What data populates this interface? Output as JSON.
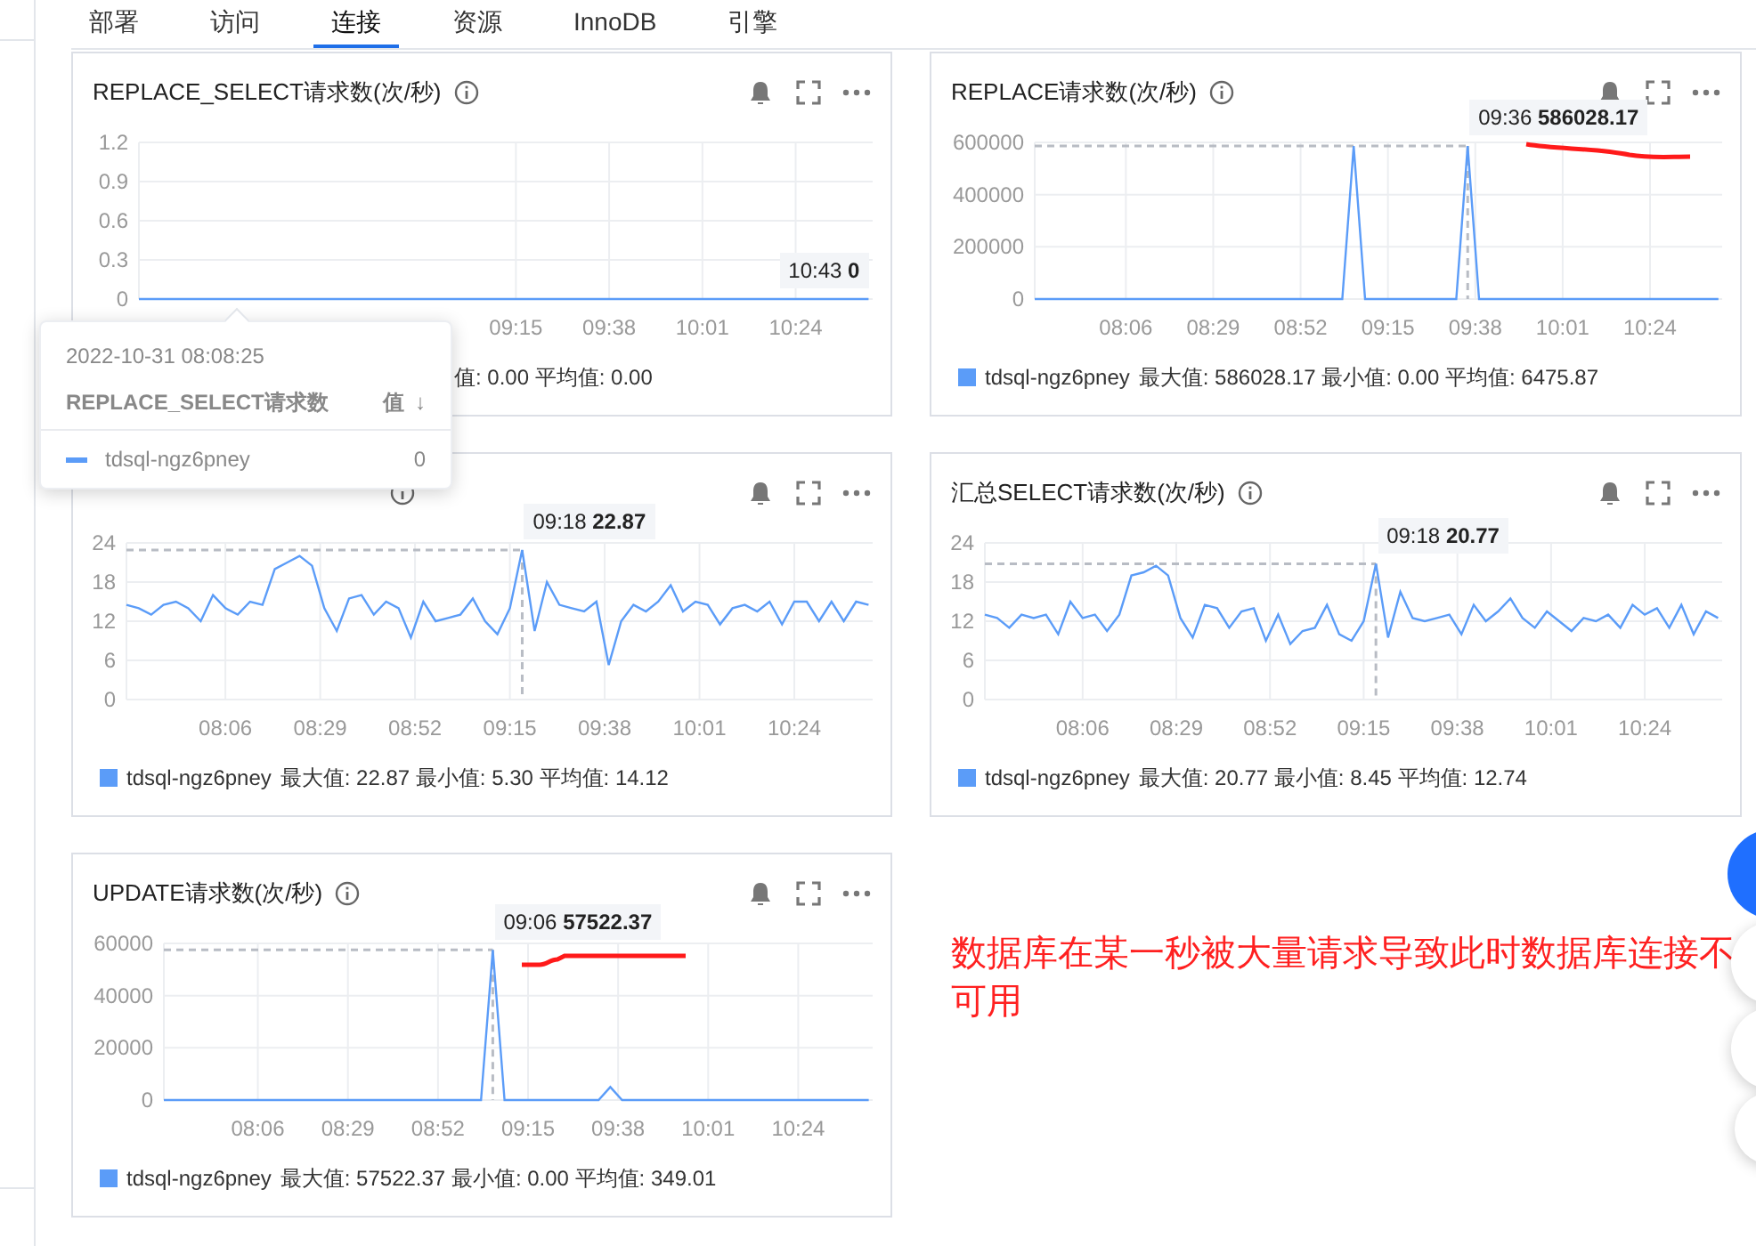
{
  "tabs": [
    {
      "label": "部署",
      "selected": false
    },
    {
      "label": "访问",
      "selected": false
    },
    {
      "label": "连接",
      "selected": true
    },
    {
      "label": "资源",
      "selected": false
    },
    {
      "label": "InnoDB",
      "selected": false
    },
    {
      "label": "引擎",
      "selected": false
    }
  ],
  "cards": [
    {
      "title": "REPLACE_SELECT请求数(次/秒)",
      "legend": {
        "swatch": false,
        "stats": "值: 0.00 平均值: 0.00"
      },
      "chart_data": {
        "type": "line",
        "grid": true,
        "annotations": [
          {
            "x": 642,
            "y": 0,
            "text": "10:43 **0**"
          }
        ],
        "x": [
          462,
          465,
          468,
          471,
          474,
          477,
          480,
          483,
          486,
          489,
          492,
          495,
          498,
          501,
          504,
          507,
          510,
          513,
          516,
          519,
          522,
          525,
          528,
          531,
          534,
          537,
          540,
          543,
          546,
          549,
          552,
          555,
          558,
          561,
          564,
          567,
          570,
          573,
          576,
          579,
          582,
          585,
          588,
          591,
          594,
          597,
          600,
          603,
          606,
          609,
          612,
          615,
          618,
          621,
          624,
          627,
          630,
          633,
          636,
          639,
          642
        ],
        "series": [
          {
            "color": "#5b9cf8",
            "values": [
              0,
              0,
              0,
              0,
              0,
              0,
              0,
              0,
              0,
              0,
              0,
              0,
              0,
              0,
              0,
              0,
              0,
              0,
              0,
              0,
              0,
              0,
              0,
              0,
              0,
              0,
              0,
              0,
              0,
              0,
              0,
              0,
              0,
              0,
              0,
              0,
              0,
              0,
              0,
              0,
              0,
              0,
              0,
              0,
              0,
              0,
              0,
              0,
              0,
              0,
              0,
              0,
              0,
              0,
              0,
              0,
              0,
              0,
              0,
              0,
              0
            ]
          }
        ],
        "xlim": [
          462,
          643
        ],
        "ylim": [
          0,
          1.2
        ],
        "yticks": [
          0,
          0.3,
          0.6,
          0.9,
          1.2
        ],
        "xticks": [
          {
            "value": 555,
            "label": "09:15"
          },
          {
            "value": 578,
            "label": "09:38"
          },
          {
            "value": 601,
            "label": "10:01"
          },
          {
            "value": 624,
            "label": "10:24"
          }
        ]
      }
    },
    {
      "title": "REPLACE请求数(次/秒)",
      "legend": {
        "swatch": true,
        "stats": "最大值: 586028.17 最小值: 0.00 平均值: 6475.87"
      },
      "chart_data": {
        "type": "line",
        "grid": true,
        "annotations": [
          {
            "x": 576,
            "y": 586000,
            "text": "09:36 **586028.17**"
          }
        ],
        "ref_lines": [
          {
            "axis": "x",
            "value": 576
          },
          {
            "axis": "y",
            "value": 586000
          }
        ],
        "x": [
          462,
          465,
          468,
          471,
          474,
          477,
          480,
          483,
          486,
          489,
          492,
          495,
          498,
          501,
          504,
          507,
          510,
          513,
          516,
          519,
          522,
          525,
          528,
          531,
          534,
          537,
          540,
          543,
          546,
          549,
          552,
          555,
          558,
          561,
          564,
          567,
          570,
          573,
          576,
          579,
          582,
          585,
          588,
          591,
          594,
          597,
          600,
          603,
          606,
          609,
          612,
          615,
          618,
          621,
          624,
          627,
          630,
          633,
          636,
          639,
          642
        ],
        "series": [
          {
            "name": "tdsql-ngz6pney",
            "color": "#5b9cf8",
            "values": [
              0,
              0,
              0,
              0,
              0,
              0,
              0,
              0,
              0,
              0,
              0,
              0,
              0,
              0,
              0,
              0,
              0,
              0,
              0,
              0,
              0,
              0,
              0,
              0,
              0,
              0,
              0,
              0,
              586000,
              0,
              0,
              0,
              0,
              0,
              0,
              0,
              0,
              0,
              586000,
              0,
              0,
              0,
              0,
              0,
              0,
              0,
              0,
              0,
              0,
              0,
              0,
              0,
              0,
              0,
              0,
              0,
              0,
              0,
              0,
              0,
              0
            ]
          }
        ],
        "xlim": [
          462,
          643
        ],
        "ylim": [
          0,
          600000
        ],
        "yticks": [
          0,
          200000,
          400000,
          600000
        ],
        "xticks": [
          {
            "value": 486,
            "label": "08:06"
          },
          {
            "value": 509,
            "label": "08:29"
          },
          {
            "value": 532,
            "label": "08:52"
          },
          {
            "value": 555,
            "label": "09:15"
          },
          {
            "value": 578,
            "label": "09:38"
          },
          {
            "value": 601,
            "label": "10:01"
          },
          {
            "value": 624,
            "label": "10:24"
          }
        ]
      }
    },
    {
      "legend": {
        "swatch": true,
        "stats": "最大值: 22.87 最小值: 5.30 平均值: 14.12"
      },
      "chart_data": {
        "type": "line",
        "grid": true,
        "annotations": [
          {
            "x": 558,
            "y": 22.9,
            "text": "09:18 **22.87**"
          }
        ],
        "ref_lines": [
          {
            "axis": "x",
            "value": 558
          },
          {
            "axis": "y",
            "value": 22.9
          }
        ],
        "x": [
          462,
          465,
          468,
          471,
          474,
          477,
          480,
          483,
          486,
          489,
          492,
          495,
          498,
          501,
          504,
          507,
          510,
          513,
          516,
          519,
          522,
          525,
          528,
          531,
          534,
          537,
          540,
          543,
          546,
          549,
          552,
          555,
          558,
          561,
          564,
          567,
          570,
          573,
          576,
          579,
          582,
          585,
          588,
          591,
          594,
          597,
          600,
          603,
          606,
          609,
          612,
          615,
          618,
          621,
          624,
          627,
          630,
          633,
          636,
          639,
          642
        ],
        "series": [
          {
            "name": "tdsql-ngz6pney",
            "color": "#5b9cf8",
            "values": [
              14.5,
              14,
              13,
              14.5,
              15,
              14,
              12,
              16,
              14,
              13,
              15,
              14.5,
              20,
              21,
              22,
              20.5,
              14,
              10.5,
              15.5,
              16,
              13,
              15,
              14,
              9.5,
              15,
              12,
              12.5,
              13,
              15.5,
              12,
              10,
              14,
              22.9,
              10.5,
              18,
              14.5,
              14,
              13.5,
              15,
              5.3,
              12,
              14.5,
              13.5,
              15,
              17.5,
              13.5,
              15,
              14.5,
              11.5,
              14,
              14.5,
              13.5,
              15,
              11.5,
              15,
              15,
              12,
              15,
              12,
              15,
              14.5
            ]
          }
        ],
        "xlim": [
          462,
          643
        ],
        "ylim": [
          0,
          24
        ],
        "yticks": [
          0,
          6,
          12,
          18,
          24
        ],
        "xticks": [
          {
            "value": 486,
            "label": "08:06"
          },
          {
            "value": 509,
            "label": "08:29"
          },
          {
            "value": 532,
            "label": "08:52"
          },
          {
            "value": 555,
            "label": "09:15"
          },
          {
            "value": 578,
            "label": "09:38"
          },
          {
            "value": 601,
            "label": "10:01"
          },
          {
            "value": 624,
            "label": "10:24"
          }
        ]
      }
    },
    {
      "title": "汇总SELECT请求数(次/秒)",
      "legend": {
        "swatch": true,
        "stats": "最大值: 20.77 最小值: 8.45 平均值: 12.74"
      },
      "chart_data": {
        "type": "line",
        "grid": true,
        "annotations": [
          {
            "x": 558,
            "y": 20.8,
            "text": "09:18 **20.77**"
          }
        ],
        "ref_lines": [
          {
            "axis": "x",
            "value": 558
          },
          {
            "axis": "y",
            "value": 20.8
          }
        ],
        "x": [
          462,
          465,
          468,
          471,
          474,
          477,
          480,
          483,
          486,
          489,
          492,
          495,
          498,
          501,
          504,
          507,
          510,
          513,
          516,
          519,
          522,
          525,
          528,
          531,
          534,
          537,
          540,
          543,
          546,
          549,
          552,
          555,
          558,
          561,
          564,
          567,
          570,
          573,
          576,
          579,
          582,
          585,
          588,
          591,
          594,
          597,
          600,
          603,
          606,
          609,
          612,
          615,
          618,
          621,
          624,
          627,
          630,
          633,
          636,
          639,
          642
        ],
        "series": [
          {
            "name": "tdsql-ngz6pney",
            "color": "#5b9cf8",
            "values": [
              13,
              12.5,
              11,
              13,
              12.5,
              13,
              10,
              15,
              12.5,
              13,
              10.5,
              13,
              19,
              19.5,
              20.5,
              19,
              12.5,
              9.5,
              14.5,
              14,
              11,
              13.5,
              14,
              9,
              13,
              8.5,
              10.5,
              11,
              14.5,
              10,
              9,
              12,
              20.8,
              9.5,
              16.5,
              12.5,
              12,
              12.5,
              13,
              10,
              14.5,
              12,
              13.5,
              15.5,
              12.5,
              11,
              13.5,
              12,
              10.5,
              12.5,
              12,
              13,
              11,
              14.5,
              13,
              14,
              11,
              14.5,
              10,
              13.5,
              12.5
            ]
          }
        ],
        "xlim": [
          462,
          643
        ],
        "ylim": [
          0,
          24
        ],
        "yticks": [
          0,
          6,
          12,
          18,
          24
        ],
        "xticks": [
          {
            "value": 486,
            "label": "08:06"
          },
          {
            "value": 509,
            "label": "08:29"
          },
          {
            "value": 532,
            "label": "08:52"
          },
          {
            "value": 555,
            "label": "09:15"
          },
          {
            "value": 578,
            "label": "09:38"
          },
          {
            "value": 601,
            "label": "10:01"
          },
          {
            "value": 624,
            "label": "10:24"
          }
        ]
      }
    },
    {
      "title": "UPDATE请求数(次/秒)",
      "legend": {
        "swatch": true,
        "stats": "最大值: 57522.37 最小值: 0.00 平均值: 349.01"
      },
      "chart_data": {
        "type": "line",
        "grid": true,
        "annotations": [
          {
            "x": 546,
            "y": 57500,
            "text": "09:06 **57522.37**"
          }
        ],
        "ref_lines": [
          {
            "axis": "x",
            "value": 546
          },
          {
            "axis": "y",
            "value": 57500
          }
        ],
        "x": [
          462,
          465,
          468,
          471,
          474,
          477,
          480,
          483,
          486,
          489,
          492,
          495,
          498,
          501,
          504,
          507,
          510,
          513,
          516,
          519,
          522,
          525,
          528,
          531,
          534,
          537,
          540,
          543,
          546,
          549,
          552,
          555,
          558,
          561,
          564,
          567,
          570,
          573,
          576,
          579,
          582,
          585,
          588,
          591,
          594,
          597,
          600,
          603,
          606,
          609,
          612,
          615,
          618,
          621,
          624,
          627,
          630,
          633,
          636,
          639,
          642
        ],
        "series": [
          {
            "name": "tdsql-ngz6pney",
            "color": "#5b9cf8",
            "values": [
              0,
              0,
              0,
              0,
              0,
              0,
              0,
              0,
              0,
              0,
              0,
              0,
              0,
              0,
              0,
              0,
              0,
              0,
              0,
              0,
              0,
              0,
              0,
              0,
              0,
              0,
              0,
              0,
              57500,
              0,
              0,
              0,
              0,
              0,
              0,
              0,
              0,
              0,
              5000,
              0,
              0,
              0,
              0,
              0,
              0,
              0,
              0,
              0,
              0,
              0,
              0,
              0,
              0,
              0,
              0,
              0,
              0,
              0,
              0,
              0,
              0
            ]
          }
        ],
        "xlim": [
          462,
          643
        ],
        "ylim": [
          0,
          60000
        ],
        "yticks": [
          0,
          20000,
          40000,
          60000
        ],
        "xticks": [
          {
            "value": 486,
            "label": "08:06"
          },
          {
            "value": 509,
            "label": "08:29"
          },
          {
            "value": 532,
            "label": "08:52"
          },
          {
            "value": 555,
            "label": "09:15"
          },
          {
            "value": 578,
            "label": "09:38"
          },
          {
            "value": 601,
            "label": "10:01"
          },
          {
            "value": 624,
            "label": "10:24"
          }
        ]
      }
    }
  ],
  "tooltip_popup": {
    "datetime": "2022-10-31 08:08:25",
    "metric": "REPLACE_SELECT请求数",
    "value_header": "值",
    "sort_icon": "↓",
    "rows": [
      {
        "name": "tdsql-ngz6pney",
        "value": "0",
        "color": "#5b9cf8"
      }
    ]
  },
  "annotation": "数据库在某一秒被大量请求导致此时数据库连接不可用"
}
